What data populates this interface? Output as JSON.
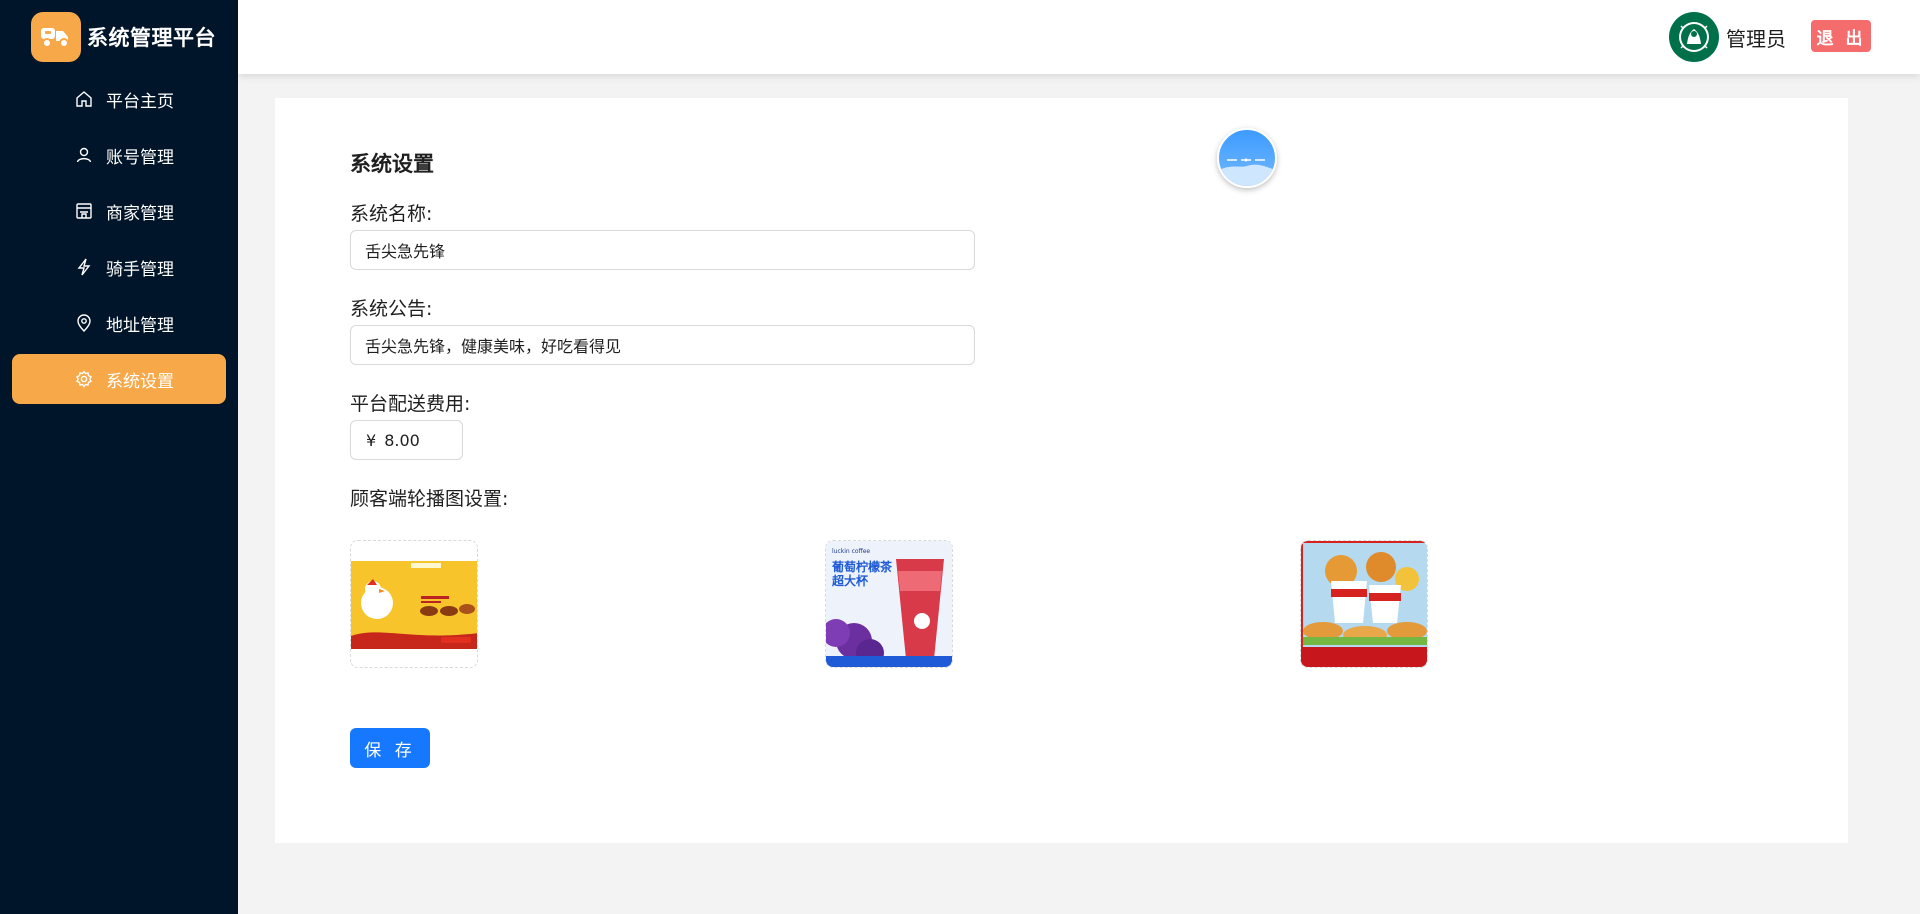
{
  "app": {
    "title": "系统管理平台"
  },
  "sidebar": {
    "items": [
      {
        "label": "平台主页",
        "icon": "home-icon"
      },
      {
        "label": "账号管理",
        "icon": "user-icon"
      },
      {
        "label": "商家管理",
        "icon": "store-icon"
      },
      {
        "label": "骑手管理",
        "icon": "lightning-icon"
      },
      {
        "label": "地址管理",
        "icon": "location-icon"
      },
      {
        "label": "系统设置",
        "icon": "gear-icon",
        "active": true
      }
    ]
  },
  "header": {
    "user_name": "管理员",
    "logout_label": "退 出"
  },
  "settings": {
    "title": "系统设置",
    "name_label": "系统名称:",
    "name_value": "舌尖急先锋",
    "notice_label": "系统公告:",
    "notice_value": "舌尖急先锋，健康美味，好吃看得见",
    "fee_label": "平台配送费用:",
    "fee_prefix": "¥",
    "fee_value": "8.00",
    "carousel_label": "顾客端轮播图设置:",
    "carousel_images": [
      {
        "name": "carousel-image-1",
        "subject": "fast-food chicken mascot promo"
      },
      {
        "name": "carousel-image-2",
        "subject": "luckin coffee grape lemon tea",
        "brand_text": "luckin coffee",
        "headline_1": "葡萄柠檬茶",
        "headline_2": "超大杯"
      },
      {
        "name": "carousel-image-3",
        "subject": "KFC fried chicken bucket promo"
      }
    ],
    "save_label": "保 存"
  },
  "colors": {
    "sidebar_bg": "#001529",
    "accent_orange": "#f7a94a",
    "primary_blue": "#1677ff",
    "danger_red": "#f56c6c"
  }
}
